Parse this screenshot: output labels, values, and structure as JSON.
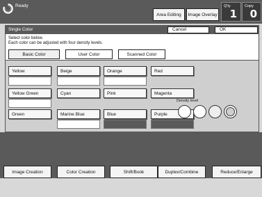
{
  "status": {
    "text": "Ready",
    "icon": "ready-ring-icon"
  },
  "top_buttons": {
    "area_editing": "Area Editing",
    "image_overlay": "Image Overlay"
  },
  "qty": {
    "label": "Q'ty",
    "value": "1"
  },
  "copy": {
    "label": "Copy",
    "value": "0"
  },
  "dialog": {
    "title": "Single Color",
    "cancel_label": "Cancel",
    "ok_label": "OK",
    "instruction_line1": "Select color below.",
    "instruction_line2": "Each color can be adjusted with four density levels.",
    "tabs": [
      {
        "label": "Basic Color",
        "selected": true
      },
      {
        "label": "User Color",
        "selected": false
      },
      {
        "label": "Scanned Color",
        "selected": false
      }
    ],
    "colors": [
      {
        "label": "Yellow"
      },
      {
        "label": "Beige"
      },
      {
        "label": "Orange"
      },
      {
        "label": "Red"
      },
      {
        "label": "Yellow Green"
      },
      {
        "label": "Cyan"
      },
      {
        "label": "Pink"
      },
      {
        "label": "Magenta"
      },
      {
        "label": "Green"
      },
      {
        "label": "Marine Blue"
      },
      {
        "label": "Blue",
        "selected": true
      },
      {
        "label": "Purple"
      }
    ],
    "density_label": "Density level",
    "density_levels": 4,
    "density_selected": 4
  },
  "bottom_tabs": [
    {
      "label": "Image Creation"
    },
    {
      "label": "Color Creation"
    },
    {
      "label": "Shift/Book"
    },
    {
      "label": "Duplex/Combine"
    },
    {
      "label": "Reduce/Enlarge"
    }
  ]
}
